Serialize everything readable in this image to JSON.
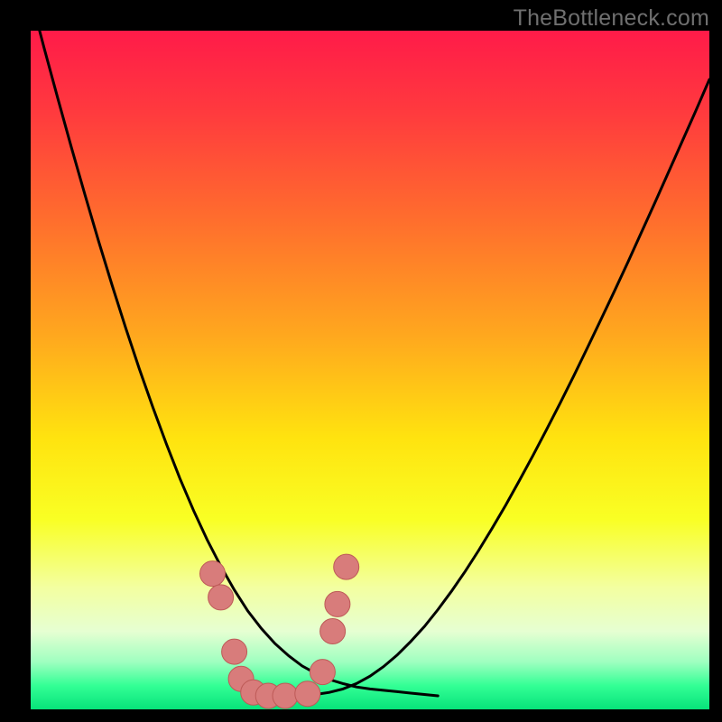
{
  "watermark": {
    "text": "TheBottleneck.com"
  },
  "colors": {
    "black": "#000000",
    "curve_stroke": "#000000",
    "marker_fill": "#d87c7b",
    "marker_stroke": "#bd5a57",
    "watermark": "#6f6f6f",
    "gradient_stops": [
      {
        "offset": 0.0,
        "color": "#ff1b49"
      },
      {
        "offset": 0.12,
        "color": "#ff3a3e"
      },
      {
        "offset": 0.28,
        "color": "#ff6e2d"
      },
      {
        "offset": 0.45,
        "color": "#ffa81e"
      },
      {
        "offset": 0.6,
        "color": "#ffe30f"
      },
      {
        "offset": 0.72,
        "color": "#f9ff24"
      },
      {
        "offset": 0.82,
        "color": "#f3ffa0"
      },
      {
        "offset": 0.885,
        "color": "#e6ffd2"
      },
      {
        "offset": 0.93,
        "color": "#9fffc0"
      },
      {
        "offset": 0.965,
        "color": "#33ff95"
      },
      {
        "offset": 1.0,
        "color": "#07e27a"
      }
    ]
  },
  "chart_data": {
    "type": "line",
    "title": "",
    "xlabel": "",
    "ylabel": "",
    "x": [
      0.0,
      0.02,
      0.04,
      0.06,
      0.08,
      0.1,
      0.12,
      0.14,
      0.16,
      0.18,
      0.2,
      0.22,
      0.24,
      0.26,
      0.28,
      0.3,
      0.32,
      0.34,
      0.36,
      0.38,
      0.4,
      0.42,
      0.44,
      0.46,
      0.48,
      0.5,
      0.52,
      0.54,
      0.56,
      0.58,
      0.6,
      0.62,
      0.64,
      0.66,
      0.68,
      0.7,
      0.72,
      0.74,
      0.76,
      0.78,
      0.8,
      0.82,
      0.84,
      0.86,
      0.88,
      0.9,
      0.92,
      0.94,
      0.96,
      0.98,
      1.0
    ],
    "series": [
      {
        "name": "left-branch",
        "values": [
          1.05,
          0.974,
          0.9,
          0.828,
          0.758,
          0.69,
          0.625,
          0.562,
          0.502,
          0.445,
          0.391,
          0.34,
          0.293,
          0.25,
          0.211,
          0.176,
          0.145,
          0.119,
          0.097,
          0.079,
          0.064,
          0.053,
          0.044,
          0.038,
          0.033,
          0.03,
          0.028,
          0.026,
          0.024,
          0.022,
          0.02,
          null,
          null,
          null,
          null,
          null,
          null,
          null,
          null,
          null,
          null,
          null,
          null,
          null,
          null,
          null,
          null,
          null,
          null,
          null,
          null
        ]
      },
      {
        "name": "right-branch",
        "values": [
          null,
          null,
          null,
          null,
          null,
          null,
          null,
          null,
          null,
          null,
          null,
          null,
          null,
          null,
          null,
          null,
          null,
          null,
          null,
          null,
          0.02,
          0.022,
          0.025,
          0.03,
          0.038,
          0.049,
          0.063,
          0.08,
          0.1,
          0.122,
          0.147,
          0.174,
          0.203,
          0.234,
          0.267,
          0.301,
          0.337,
          0.374,
          0.412,
          0.451,
          0.491,
          0.532,
          0.574,
          0.616,
          0.659,
          0.703,
          0.747,
          0.792,
          0.837,
          0.882,
          0.928
        ]
      }
    ],
    "markers": [
      {
        "x": 0.268,
        "y": 0.2
      },
      {
        "x": 0.28,
        "y": 0.165
      },
      {
        "x": 0.3,
        "y": 0.085
      },
      {
        "x": 0.31,
        "y": 0.045
      },
      {
        "x": 0.328,
        "y": 0.025
      },
      {
        "x": 0.35,
        "y": 0.02
      },
      {
        "x": 0.375,
        "y": 0.02
      },
      {
        "x": 0.408,
        "y": 0.023
      },
      {
        "x": 0.43,
        "y": 0.055
      },
      {
        "x": 0.445,
        "y": 0.115
      },
      {
        "x": 0.452,
        "y": 0.155
      },
      {
        "x": 0.465,
        "y": 0.21
      }
    ],
    "xlim": [
      0,
      1
    ],
    "ylim": [
      0,
      1
    ]
  }
}
